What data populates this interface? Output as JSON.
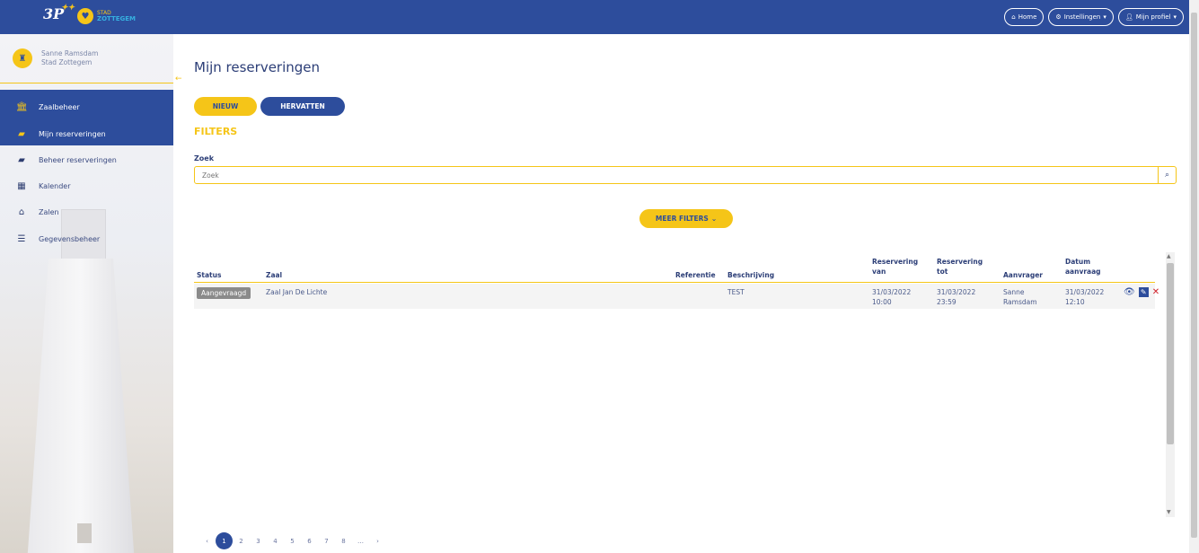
{
  "topbar": {
    "brand_logo": "3P",
    "city_logo_top": "STAD",
    "city_logo_bottom": "ZOTTEGEM",
    "nav": [
      {
        "label": "Home",
        "icon": "home-icon"
      },
      {
        "label": "Instellingen",
        "icon": "gear-icon"
      },
      {
        "label": "Mijn profiel",
        "icon": "user-icon"
      }
    ]
  },
  "user": {
    "name": "Sanne Ramsdam",
    "org": "Stad Zottegem"
  },
  "sidebar": {
    "items": [
      {
        "label": "Zaalbeheer",
        "icon": "building-icon"
      },
      {
        "label": "Mijn reserveringen",
        "icon": "book-icon"
      },
      {
        "label": "Beheer reserveringen",
        "icon": "book-icon"
      },
      {
        "label": "Kalender",
        "icon": "calendar-icon"
      },
      {
        "label": "Zalen",
        "icon": "home-icon"
      },
      {
        "label": "Gegevensbeheer",
        "icon": "database-icon"
      }
    ]
  },
  "main": {
    "title": "Mijn reserveringen",
    "new_label": "NIEUW",
    "resume_label": "HERVATTEN",
    "filters_heading": "FILTERS",
    "search_label": "Zoek",
    "search_placeholder": "Zoek",
    "more_filters_label": "MEER FILTERS"
  },
  "table": {
    "headers": {
      "status": "Status",
      "zaal": "Zaal",
      "referentie": "Referentie",
      "beschrijving": "Beschrijving",
      "van_1": "Reservering",
      "van_2": "van",
      "tot_1": "Reservering",
      "tot_2": "tot",
      "aanvrager": "Aanvrager",
      "datum_1": "Datum",
      "datum_2": "aanvraag"
    },
    "rows": [
      {
        "status": "Aangevraagd",
        "zaal": "Zaal Jan De Lichte",
        "referentie": "",
        "beschrijving": "TEST",
        "van_date": "31/03/2022",
        "van_time": "10:00",
        "tot_date": "31/03/2022",
        "tot_time": "23:59",
        "aanvrager_1": "Sanne",
        "aanvrager_2": "Ramsdam",
        "datum_date": "31/03/2022",
        "datum_time": "12:10"
      }
    ]
  },
  "pagination": {
    "prev": "‹",
    "pages": [
      "1",
      "2",
      "3",
      "4",
      "5",
      "6",
      "7",
      "8",
      "…"
    ],
    "next": "›",
    "current": "1"
  },
  "colors": {
    "primary": "#2d4d9c",
    "accent": "#f5c518",
    "status_badge": "#8a8a8a",
    "delete": "#d0212a"
  }
}
